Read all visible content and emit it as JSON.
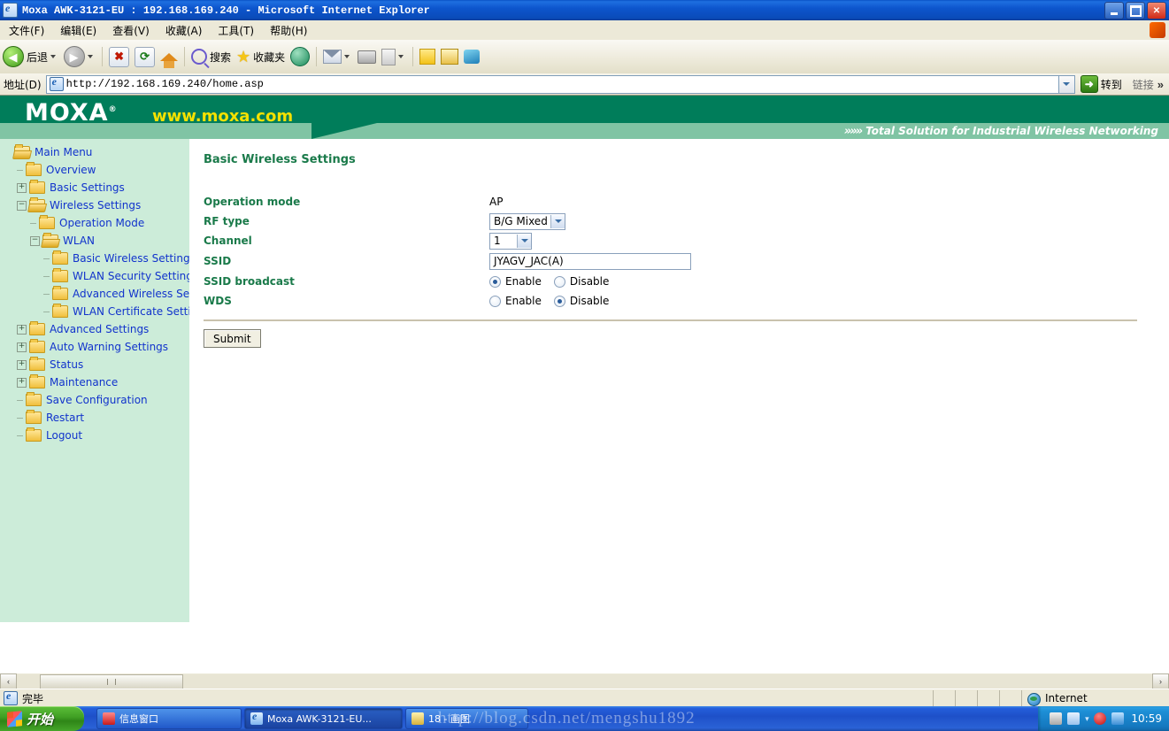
{
  "window": {
    "title": "Moxa AWK-3121-EU : 192.168.169.240 - Microsoft Internet Explorer",
    "minimize_label": "Minimize",
    "maximize_label": "Maximize",
    "close_label": "Close"
  },
  "menubar": {
    "items": [
      {
        "label": "文件(F)"
      },
      {
        "label": "编辑(E)"
      },
      {
        "label": "查看(V)"
      },
      {
        "label": "收藏(A)"
      },
      {
        "label": "工具(T)"
      },
      {
        "label": "帮助(H)"
      }
    ]
  },
  "toolbar": {
    "back_label": "后退",
    "forward_label": "",
    "stop_glyph": "✖",
    "refresh_glyph": "⟳",
    "search_label": "搜索",
    "favorites_label": "收藏夹",
    "items": [
      "后退",
      "搜索",
      "收藏夹"
    ]
  },
  "address": {
    "label": "地址(D)",
    "value": "http://192.168.169.240/home.asp",
    "go_label": "转到",
    "links_label": "链接",
    "overflow_glyph": "»"
  },
  "banner": {
    "brand": "MOXA",
    "registered": "®",
    "url": "www.moxa.com",
    "tagline": "Total Solution for Industrial Wireless Networking",
    "tagline_arrows": "»»»"
  },
  "sidebar": {
    "items": [
      {
        "label": "Main Menu",
        "depth": 0,
        "expander": "open",
        "folder": "open"
      },
      {
        "label": "Overview",
        "depth": 1,
        "expander": "none",
        "folder": "closed"
      },
      {
        "label": "Basic Settings",
        "depth": 1,
        "expander": "plus",
        "folder": "closed"
      },
      {
        "label": "Wireless Settings",
        "depth": 1,
        "expander": "minus",
        "folder": "open"
      },
      {
        "label": "Operation Mode",
        "depth": 2,
        "expander": "none",
        "folder": "closed"
      },
      {
        "label": "WLAN",
        "depth": 2,
        "expander": "minus",
        "folder": "open"
      },
      {
        "label": "Basic Wireless Settings",
        "depth": 3,
        "expander": "none",
        "folder": "closed"
      },
      {
        "label": "WLAN Security Settings",
        "depth": 3,
        "expander": "none",
        "folder": "closed"
      },
      {
        "label": "Advanced Wireless Settings",
        "depth": 3,
        "expander": "none",
        "folder": "closed"
      },
      {
        "label": "WLAN Certificate Settings",
        "depth": 3,
        "expander": "none",
        "folder": "closed"
      },
      {
        "label": "Advanced Settings",
        "depth": 1,
        "expander": "plus",
        "folder": "closed"
      },
      {
        "label": "Auto Warning Settings",
        "depth": 1,
        "expander": "plus",
        "folder": "closed"
      },
      {
        "label": "Status",
        "depth": 1,
        "expander": "plus",
        "folder": "closed"
      },
      {
        "label": "Maintenance",
        "depth": 1,
        "expander": "plus",
        "folder": "closed"
      },
      {
        "label": "Save Configuration",
        "depth": 1,
        "expander": "none",
        "folder": "closed"
      },
      {
        "label": "Restart",
        "depth": 1,
        "expander": "none",
        "folder": "closed"
      },
      {
        "label": "Logout",
        "depth": 1,
        "expander": "none",
        "folder": "closed"
      }
    ]
  },
  "main": {
    "page_title": "Basic Wireless Settings",
    "fields": {
      "operation_mode": {
        "label": "Operation mode",
        "value": "AP"
      },
      "rf_type": {
        "label": "RF type",
        "value": "B/G Mixed"
      },
      "channel": {
        "label": "Channel",
        "value": "1"
      },
      "ssid": {
        "label": "SSID",
        "value": "JYAGV_JAC(A)",
        "placeholder": ""
      },
      "ssid_broadcast": {
        "label": "SSID broadcast",
        "enable_label": "Enable",
        "disable_label": "Disable",
        "selected": "Enable"
      },
      "wds": {
        "label": "WDS",
        "enable_label": "Enable",
        "disable_label": "Disable",
        "selected": "Disable"
      }
    },
    "submit_label": "Submit"
  },
  "scrollbar": {
    "left_glyph": "‹",
    "right_glyph": "›"
  },
  "statusbar": {
    "text": "完毕",
    "zone": "Internet"
  },
  "taskbar": {
    "start_label": "开始",
    "tasks": [
      {
        "label": "信息窗口",
        "icon": "red",
        "active": false
      },
      {
        "label": "Moxa AWK-3121-EU...",
        "icon": "ie",
        "active": true
      },
      {
        "label": "18 - 画图",
        "icon": "paint",
        "active": false
      }
    ],
    "clock": "10:59"
  },
  "watermark": {
    "text": "http://blog.csdn.net/mengshu1892"
  },
  "colors": {
    "brand_green_dark": "#007d5a",
    "brand_green_light": "#80c4a4",
    "sidebar_bg": "#ccecd9",
    "label_green": "#1a7a4a",
    "link_blue": "#1133cc",
    "titlebar_blue": "#0d55cd"
  }
}
